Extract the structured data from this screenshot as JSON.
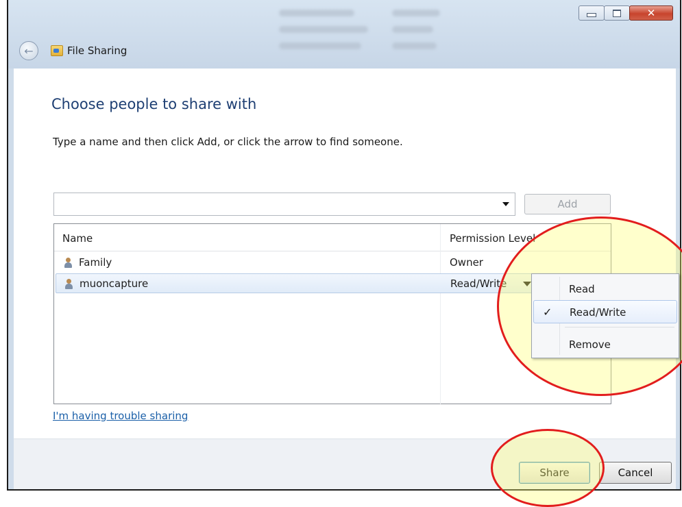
{
  "window": {
    "title": "File Sharing",
    "controls": {
      "minimize": "minimize",
      "maximize": "maximize",
      "close": "x"
    }
  },
  "content": {
    "heading": "Choose people to share with",
    "instructions": "Type a name and then click Add, or click the arrow to find someone."
  },
  "picker": {
    "value": "",
    "add_label": "Add"
  },
  "people_list": {
    "columns": [
      "Name",
      "Permission Level"
    ],
    "rows": [
      {
        "name": "Family",
        "permission": "Owner"
      },
      {
        "name": "muoncapture",
        "permission": "Read/Write"
      }
    ]
  },
  "permission_menu": {
    "items": [
      {
        "label": "Read",
        "checked": false
      },
      {
        "label": "Read/Write",
        "checked": true,
        "check_glyph": "✓"
      },
      {
        "label": "Remove",
        "checked": false
      }
    ]
  },
  "footer": {
    "trouble_link": "I'm having trouble sharing",
    "share_label": "Share",
    "cancel_label": "Cancel"
  },
  "colors": {
    "annotation_circle": "#e21d1d",
    "heading": "#1e3f73",
    "link": "#1a5fa8"
  }
}
